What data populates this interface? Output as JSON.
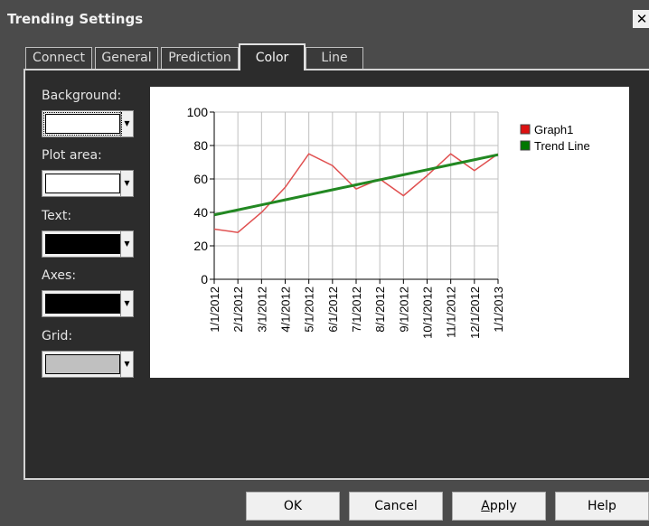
{
  "window": {
    "title": "Trending Settings",
    "close_glyph": "✕"
  },
  "tabs": [
    {
      "label": "Connect",
      "active": false
    },
    {
      "label": "General",
      "active": false
    },
    {
      "label": "Prediction",
      "active": false
    },
    {
      "label": "Color",
      "active": true
    },
    {
      "label": "Line",
      "active": false
    }
  ],
  "color_settings": [
    {
      "label": "Background:",
      "color": "#ffffff"
    },
    {
      "label": "Plot area:",
      "color": "#ffffff"
    },
    {
      "label": "Text:",
      "color": "#000000"
    },
    {
      "label": "Axes:",
      "color": "#000000"
    },
    {
      "label": "Grid:",
      "color": "#c0c0c0"
    }
  ],
  "dropdown_arrow": "▼",
  "chart_data": {
    "type": "line",
    "categories": [
      "1/1/2012",
      "2/1/2012",
      "3/1/2012",
      "4/1/2012",
      "5/1/2012",
      "6/1/2012",
      "7/1/2012",
      "8/1/2012",
      "9/1/2012",
      "10/1/2012",
      "11/1/2012",
      "12/1/2012",
      "1/1/2013"
    ],
    "series": [
      {
        "name": "Graph1",
        "color": "#e05050",
        "legend_color": "#dd1111",
        "values": [
          30,
          28,
          40,
          55,
          75,
          68,
          54,
          60,
          50,
          62,
          75,
          65,
          75
        ]
      },
      {
        "name": "Trend Line",
        "color": "#228822",
        "legend_color": "#007700",
        "values": [
          38.5,
          41.5,
          44.5,
          47.5,
          50.5,
          53.5,
          56.5,
          59.5,
          62.5,
          65.5,
          68.5,
          71.5,
          74.5
        ]
      }
    ],
    "yticks": [
      0,
      20,
      40,
      60,
      80,
      100
    ],
    "ylim": [
      0,
      100
    ],
    "grid": true,
    "legend_position": "right"
  },
  "buttons": {
    "ok": "OK",
    "cancel": "Cancel",
    "apply": "Apply",
    "help": "Help"
  }
}
